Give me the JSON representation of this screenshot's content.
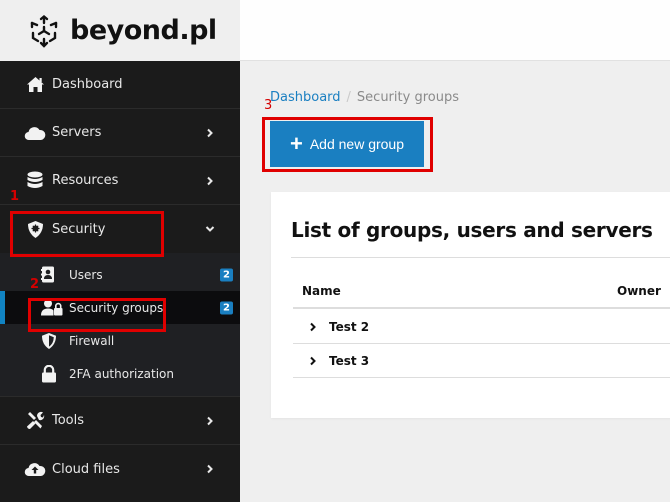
{
  "brand": {
    "name": "beyond.pl",
    "icon": "cube-arrows-logo"
  },
  "sidebar": {
    "items": [
      {
        "label": "Dashboard",
        "icon": "home-icon",
        "has_chevron": false
      },
      {
        "label": "Servers",
        "icon": "cloud-icon",
        "has_chevron": true,
        "chevron": "chevron-right"
      },
      {
        "label": "Resources",
        "icon": "database-icon",
        "has_chevron": true,
        "chevron": "chevron-right"
      },
      {
        "label": "Security",
        "icon": "shield-icon",
        "has_chevron": true,
        "chevron": "chevron-down",
        "expanded": true,
        "children": [
          {
            "label": "Users",
            "icon": "address-book-icon",
            "badge": "2"
          },
          {
            "label": "Security groups",
            "icon": "user-lock-icon",
            "badge": "2",
            "active": true
          },
          {
            "label": "Firewall",
            "icon": "shield-half-icon"
          },
          {
            "label": "2FA authorization",
            "icon": "lock-icon"
          }
        ]
      },
      {
        "label": "Tools",
        "icon": "tools-icon",
        "has_chevron": true,
        "chevron": "chevron-right"
      },
      {
        "label": "Cloud files",
        "icon": "cloud-upload-icon",
        "has_chevron": true,
        "chevron": "chevron-right"
      }
    ]
  },
  "breadcrumb": {
    "home": "Dashboard",
    "separator": "/",
    "current": "Security groups"
  },
  "toolbar": {
    "add_label": "Add new group",
    "add_icon": "plus-icon"
  },
  "card": {
    "title": "List of groups, users and servers",
    "columns": [
      "Name",
      "Owner"
    ],
    "rows": [
      {
        "name": "Test 2",
        "owner": ""
      },
      {
        "name": "Test 3",
        "owner": ""
      }
    ]
  },
  "annotations": [
    {
      "number": "1",
      "target": "Security"
    },
    {
      "number": "2",
      "target": "Security groups"
    },
    {
      "number": "3",
      "target": "Add new group"
    }
  ],
  "colors": {
    "accent": "#1a7fc1",
    "sidebar_bg": "#1b1b1b",
    "annotation": "#e00000"
  }
}
